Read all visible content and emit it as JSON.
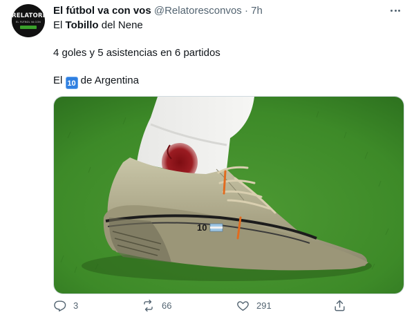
{
  "tweet": {
    "avatar": {
      "logo_text": "RELATORES",
      "logo_sub": "EL FÚTBOL VA CON VOS"
    },
    "display_name": "El fútbol va con vos",
    "handle": "@Relatoresconvos",
    "separator": "·",
    "time": "7h",
    "text": {
      "line1_start": "El ",
      "line1_bold": "Tobillo",
      "line1_end": " del Nene",
      "line2": "4 goles y 5 asistencias en 6 partidos",
      "line3_start": "El ",
      "line3_keycap": "10",
      "line3_end": " de Argentina"
    },
    "media": {
      "boot_number": "10"
    },
    "actions": {
      "replies": "3",
      "retweets": "66",
      "likes": "291"
    }
  },
  "icons": {
    "more": "more-horizontal-icon",
    "reply": "reply-icon",
    "retweet": "retweet-icon",
    "like": "heart-icon",
    "share": "share-icon"
  },
  "colors": {
    "text_primary": "#0f1419",
    "text_secondary": "#536471",
    "border": "#cfd9de",
    "keycap_blue": "#2f7fe0"
  }
}
